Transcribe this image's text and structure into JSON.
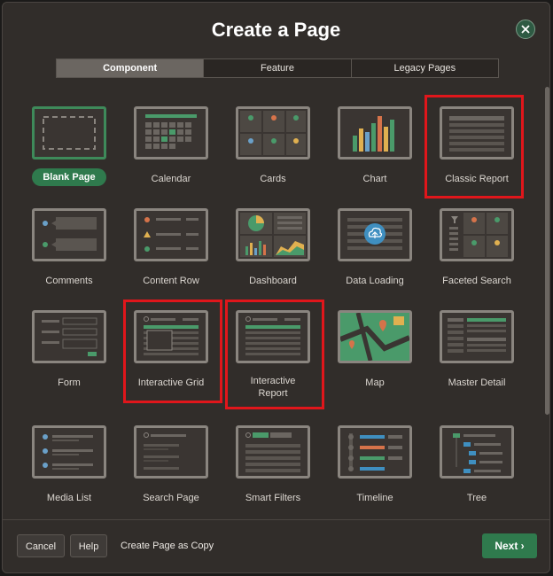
{
  "dialog": {
    "title": "Create a Page",
    "close_icon": "close-icon"
  },
  "tabs": [
    {
      "label": "Component",
      "active": true
    },
    {
      "label": "Feature",
      "active": false
    },
    {
      "label": "Legacy Pages",
      "active": false
    }
  ],
  "items": [
    {
      "label": "Blank Page",
      "icon": "blank-page-icon",
      "selected": true
    },
    {
      "label": "Calendar",
      "icon": "calendar-icon"
    },
    {
      "label": "Cards",
      "icon": "cards-icon"
    },
    {
      "label": "Chart",
      "icon": "chart-icon"
    },
    {
      "label": "Classic Report",
      "icon": "classic-report-icon",
      "highlighted": true
    },
    {
      "label": "Comments",
      "icon": "comments-icon"
    },
    {
      "label": "Content Row",
      "icon": "content-row-icon"
    },
    {
      "label": "Dashboard",
      "icon": "dashboard-icon"
    },
    {
      "label": "Data Loading",
      "icon": "data-loading-icon"
    },
    {
      "label": "Faceted Search",
      "icon": "faceted-search-icon"
    },
    {
      "label": "Form",
      "icon": "form-icon"
    },
    {
      "label": "Interactive Grid",
      "icon": "interactive-grid-icon",
      "highlighted": true
    },
    {
      "label": "Interactive\nReport",
      "icon": "interactive-report-icon",
      "highlighted": true
    },
    {
      "label": "Map",
      "icon": "map-icon"
    },
    {
      "label": "Master Detail",
      "icon": "master-detail-icon"
    },
    {
      "label": "Media List",
      "icon": "media-list-icon"
    },
    {
      "label": "Search Page",
      "icon": "search-page-icon"
    },
    {
      "label": "Smart Filters",
      "icon": "smart-filters-icon"
    },
    {
      "label": "Timeline",
      "icon": "timeline-icon"
    },
    {
      "label": "Tree",
      "icon": "tree-icon"
    }
  ],
  "footer": {
    "cancel_label": "Cancel",
    "help_label": "Help",
    "copy_label": "Create Page as Copy",
    "next_label": "Next"
  },
  "colors": {
    "accent": "#2f7a4d",
    "highlight": "#e0161b",
    "background": "#312d2a"
  }
}
